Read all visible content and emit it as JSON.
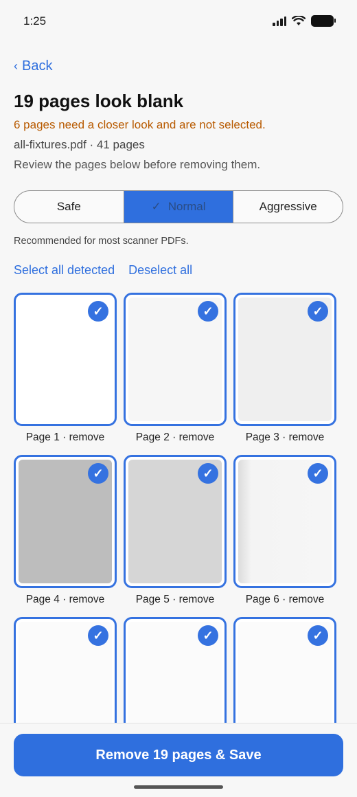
{
  "status": {
    "time": "1:25"
  },
  "nav": {
    "back_label": "Back"
  },
  "header": {
    "title": "19 pages look blank",
    "warning": "6 pages need a closer look and are not selected.",
    "file_info": "all-fixtures.pdf · 41 pages",
    "review_hint": "Review the pages below before removing them."
  },
  "sensitivity": {
    "options": [
      "Safe",
      "Normal",
      "Aggressive"
    ],
    "selected": "Normal",
    "hint": "Recommended for most scanner PDFs."
  },
  "selection": {
    "select_all": "Select all detected",
    "deselect_all": "Deselect all"
  },
  "pages": [
    {
      "label": "Page 1 · remove",
      "selected": true,
      "fill": "#ffffff"
    },
    {
      "label": "Page 2 · remove",
      "selected": true,
      "fill": "#f6f6f6"
    },
    {
      "label": "Page 3 · remove",
      "selected": true,
      "fill": "#efefef"
    },
    {
      "label": "Page 4 · remove",
      "selected": true,
      "fill": "#bdbdbd"
    },
    {
      "label": "Page 5 · remove",
      "selected": true,
      "fill": "#d6d6d6"
    },
    {
      "label": "Page 6 · remove",
      "selected": true,
      "fill": "#f4f4f4"
    },
    {
      "label": "",
      "selected": true,
      "fill": "#fbfbfb"
    },
    {
      "label": "",
      "selected": true,
      "fill": "#fbfbfb"
    },
    {
      "label": "",
      "selected": true,
      "fill": "#fbfbfb"
    }
  ],
  "action": {
    "primary_label": "Remove 19 pages & Save"
  },
  "colors": {
    "accent": "#2f6fde",
    "warning": "#b85a00"
  }
}
